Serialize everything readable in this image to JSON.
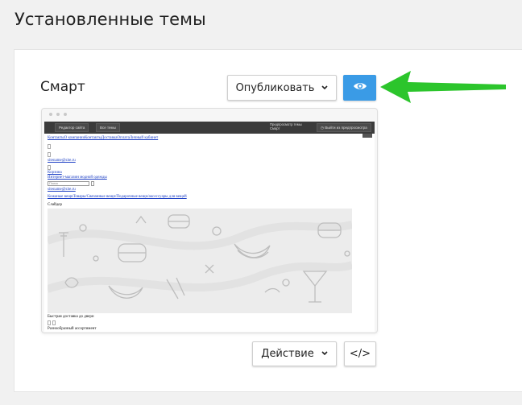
{
  "page": {
    "title": "Установленные темы"
  },
  "theme": {
    "name": "Смарт",
    "publish_label": "Опубликовать",
    "action_label": "Действие",
    "code_label": "</>"
  },
  "preview": {
    "topbar": {
      "editor": "Редактор сайта",
      "all_themes": "Все темы",
      "preview_title": "Предпросмотр темы",
      "preview_theme": "Смарт",
      "exit": "Выйти из предпросмотра"
    },
    "nav_links": "КонтактыО компанииКонтактыДоставкаОплатаЛичный кабинет",
    "email_1": "sitename@site.ru",
    "cart_link": "Корзина",
    "shop_name": "Интернет-магазин модной одежды",
    "search_placeholder": "Поиск",
    "email_2": "sitename@site.ru",
    "categories": "Кожаные вещиТовары/Связанные вещи/Подарочные вещи/аксессуары для вещей",
    "slider_label": "Слайдер",
    "footer_1": "Быстрая доставка до двери",
    "footer_2": "Разнообразный ассортимент"
  },
  "colors": {
    "accent": "#3a9be6",
    "arrow": "#2cc52c"
  },
  "icons": {
    "preview_button": "eye-icon",
    "dropdown": "chevron-down-icon",
    "code": "code-icon"
  }
}
